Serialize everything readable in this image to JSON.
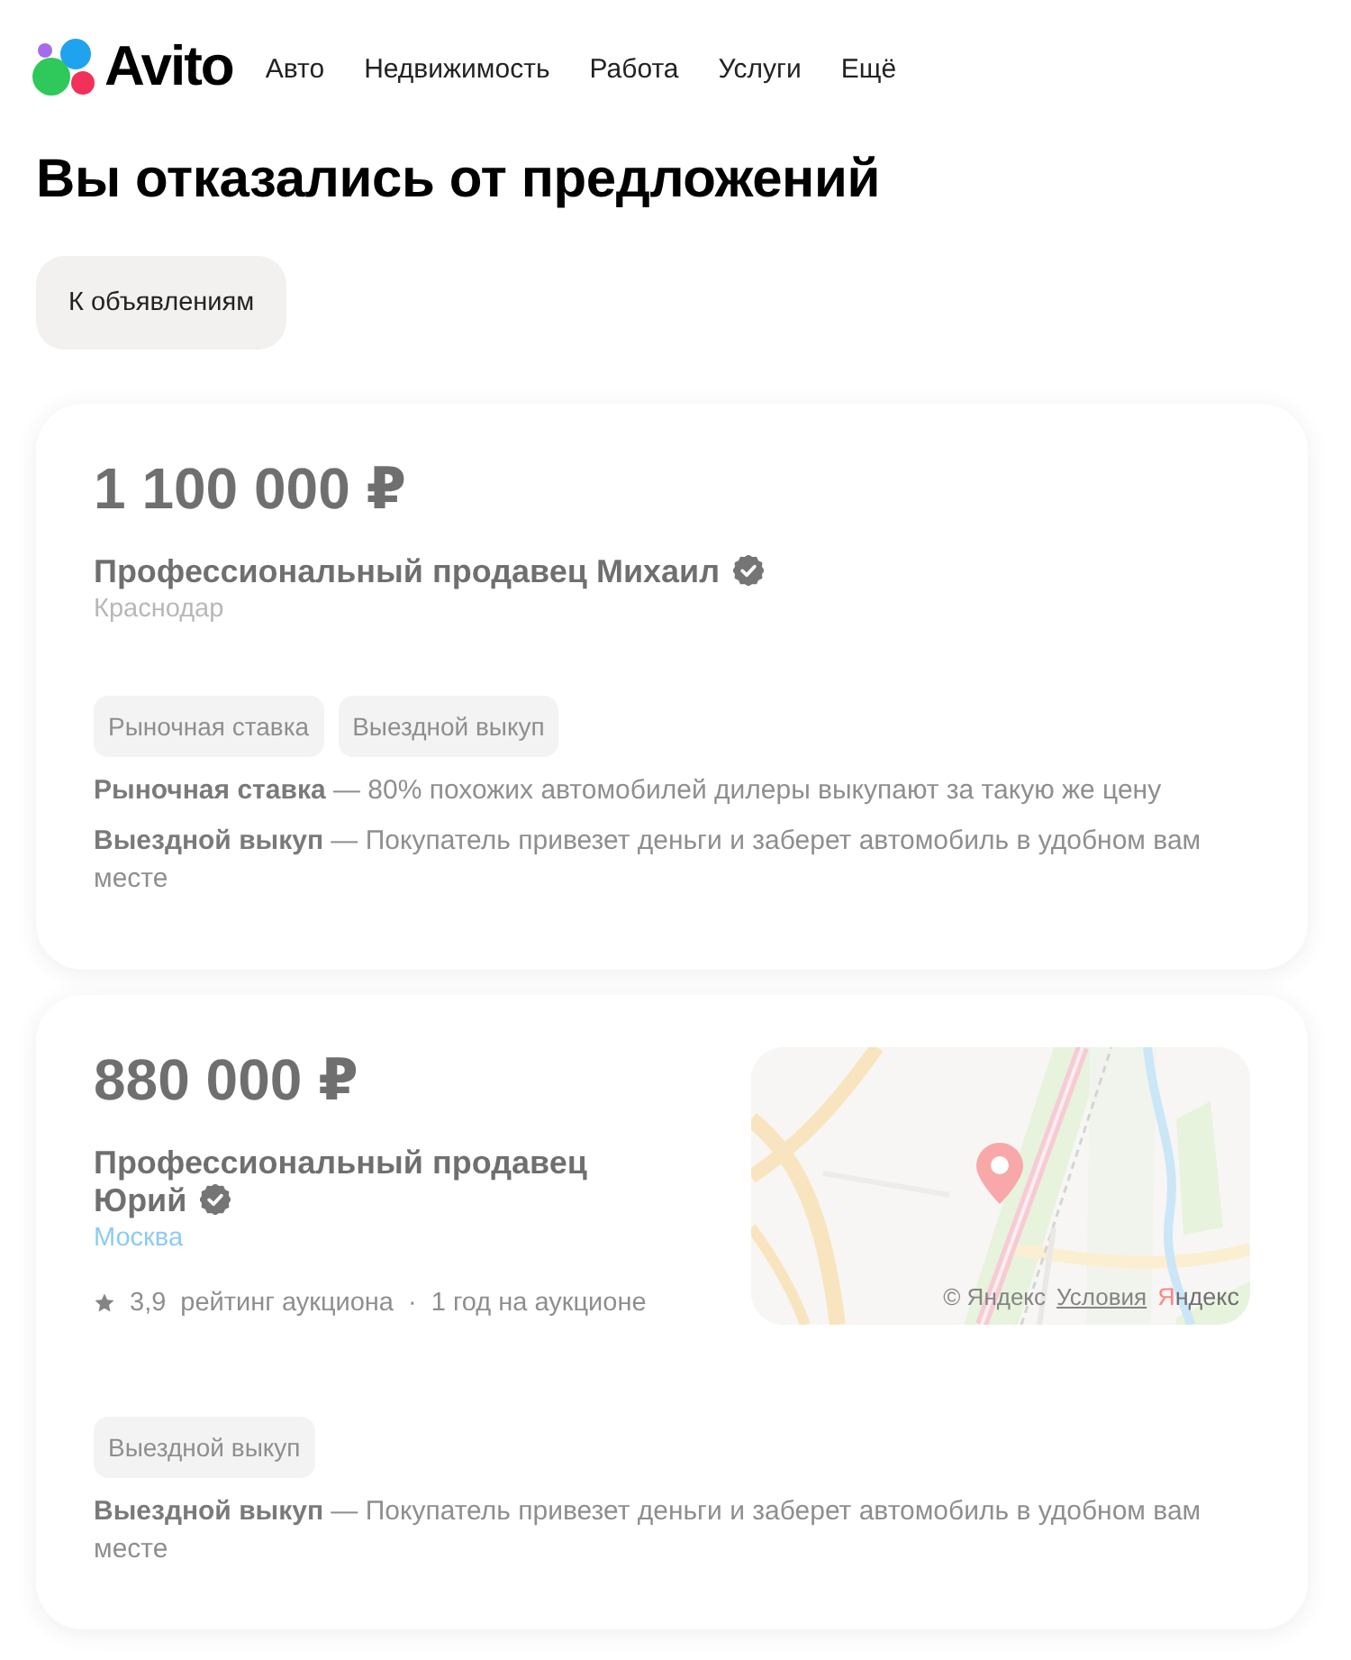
{
  "header": {
    "logo": "Avito",
    "nav": [
      "Авто",
      "Недвижимость",
      "Работа",
      "Услуги",
      "Ещё"
    ]
  },
  "title": "Вы отказались от предложений",
  "back_button": "К объявлениям",
  "offers": [
    {
      "disabled": true,
      "price": "1 100 000 ₽",
      "seller": "Профессиональный продавец Михаил",
      "verified": true,
      "city": "Краснодар",
      "city_link": false,
      "tags": [
        "Рыночная ставка",
        "Выездной выкуп"
      ],
      "notes": [
        "**Рыночная ставка** — 80% похожих автомобилей дилеры выкупают за такую же цену",
        "**Выездной выкуп** — Покупатель привезет деньги и заберет автомобиль в удобном вам месте"
      ]
    },
    {
      "disabled": true,
      "price": "880 000 ₽",
      "seller": "Профессиональный продавец Юрий",
      "verified": true,
      "city": "Москва",
      "city_link": true,
      "rating": {
        "value": "3,9",
        "label": "рейтинг аукциона"
      },
      "separator": "·",
      "tenure": "1 год на аукционе",
      "map": {
        "attribution": "© Яндекс",
        "terms_link": "Условия",
        "logo": "Яндекс"
      },
      "tags": [
        "Выездной выкуп"
      ],
      "notes": [
        "**Выездной выкуп** — Покупатель привезет деньги и заберет автомобиль в удобном вам месте"
      ]
    }
  ]
}
